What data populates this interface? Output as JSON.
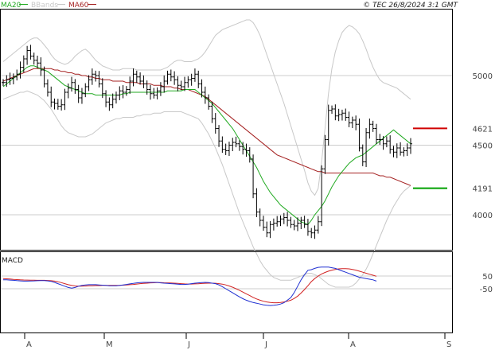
{
  "legend": [
    {
      "label": "MA20",
      "color": "#22aa22"
    },
    {
      "label": "BBands",
      "color": "#c8c8c8"
    },
    {
      "label": "MA60",
      "color": "#a52222"
    }
  ],
  "copyright": "© TEC 26/8/2024 3:1 GMT",
  "macd_title": "MACD",
  "colors": {
    "price": "#000000",
    "ma20": "#22aa22",
    "ma60": "#a52222",
    "bbands": "#c8c8c8",
    "macd": "#1f2fd1",
    "signal": "#d12222",
    "target_high": "#d00000",
    "target_low": "#00a000",
    "grid": "#cccccc",
    "frame": "#000000"
  },
  "chart_data": {
    "type": "ohlc",
    "price_axis": {
      "ticks": [
        4000,
        4500,
        5000
      ],
      "tick_labels": [
        "4000",
        "4500",
        "5000"
      ]
    },
    "macd_axis": {
      "ticks": [
        50,
        -50
      ],
      "tick_labels": [
        "50",
        "-50"
      ]
    },
    "x_axis": {
      "month_labels": [
        "A",
        "M",
        "J",
        "J",
        "A",
        "S"
      ]
    },
    "targets": [
      {
        "label": "4621",
        "value": 4621,
        "kind": "high"
      },
      {
        "label": "4191",
        "value": 4191,
        "kind": "low"
      }
    ],
    "close": [
      4950,
      4970,
      4980,
      4990,
      5010,
      5060,
      5120,
      5180,
      5140,
      5110,
      5090,
      5040,
      4940,
      4880,
      4810,
      4800,
      4780,
      4790,
      4880,
      4910,
      4950,
      4900,
      4840,
      4870,
      4920,
      4970,
      5010,
      5000,
      4940,
      4870,
      4810,
      4790,
      4830,
      4860,
      4890,
      4880,
      4900,
      4960,
      5010,
      4990,
      4960,
      4940,
      4900,
      4870,
      4860,
      4890,
      4920,
      4960,
      5010,
      4990,
      4970,
      4930,
      4920,
      4950,
      4970,
      4980,
      5010,
      4940,
      4880,
      4840,
      4780,
      4690,
      4620,
      4530,
      4470,
      4460,
      4500,
      4520,
      4510,
      4490,
      4470,
      4460,
      4400,
      4150,
      4020,
      3960,
      3910,
      3870,
      3930,
      3940,
      3950,
      3970,
      3980,
      3960,
      3930,
      3920,
      3940,
      3960,
      3930,
      3880,
      3870,
      3890,
      3950,
      4330,
      4540,
      4750,
      4760,
      4710,
      4720,
      4730,
      4700,
      4660,
      4680,
      4650,
      4480,
      4380,
      4590,
      4650,
      4620,
      4540,
      4540,
      4510,
      4530,
      4470,
      4450,
      4480,
      4450,
      4460,
      4480,
      4510
    ],
    "ma20": [
      4920,
      4940,
      4960,
      4980,
      5000,
      5020,
      5040,
      5060,
      5070,
      5070,
      5060,
      5050,
      5040,
      5030,
      5010,
      4990,
      4970,
      4950,
      4930,
      4920,
      4910,
      4900,
      4890,
      4880,
      4870,
      4870,
      4870,
      4860,
      4860,
      4860,
      4860,
      4860,
      4860,
      4860,
      4860,
      4870,
      4870,
      4880,
      4880,
      4880,
      4880,
      4880,
      4880,
      4880,
      4880,
      4880,
      4880,
      4880,
      4890,
      4890,
      4890,
      4890,
      4890,
      4900,
      4900,
      4900,
      4900,
      4880,
      4860,
      4840,
      4820,
      4800,
      4770,
      4740,
      4710,
      4680,
      4650,
      4620,
      4580,
      4540,
      4500,
      4460,
      4420,
      4380,
      4340,
      4290,
      4240,
      4200,
      4160,
      4130,
      4100,
      4070,
      4050,
      4030,
      4010,
      3990,
      3970,
      3950,
      3940,
      3930,
      3960,
      4000,
      4030,
      4060,
      4100,
      4150,
      4200,
      4240,
      4280,
      4310,
      4340,
      4370,
      4390,
      4410,
      4420,
      4430,
      4450,
      4470,
      4490,
      4510,
      4530,
      4550,
      4570,
      4590,
      4610,
      4590,
      4570,
      4550,
      4530,
      4510
    ],
    "ma60": [
      4960,
      4970,
      4980,
      4990,
      5000,
      5010,
      5020,
      5030,
      5040,
      5050,
      5050,
      5050,
      5050,
      5050,
      5050,
      5040,
      5040,
      5030,
      5030,
      5020,
      5020,
      5010,
      5010,
      5000,
      5000,
      4990,
      4990,
      4980,
      4980,
      4970,
      4970,
      4970,
      4960,
      4960,
      4960,
      4960,
      4950,
      4950,
      4950,
      4950,
      4940,
      4940,
      4940,
      4940,
      4930,
      4930,
      4930,
      4920,
      4920,
      4920,
      4910,
      4910,
      4900,
      4900,
      4900,
      4890,
      4880,
      4870,
      4860,
      4850,
      4830,
      4810,
      4790,
      4770,
      4750,
      4730,
      4710,
      4690,
      4670,
      4650,
      4630,
      4610,
      4590,
      4570,
      4550,
      4530,
      4510,
      4490,
      4470,
      4450,
      4430,
      4420,
      4410,
      4400,
      4390,
      4380,
      4370,
      4360,
      4350,
      4340,
      4330,
      4320,
      4310,
      4310,
      4300,
      4300,
      4300,
      4300,
      4300,
      4300,
      4300,
      4300,
      4300,
      4300,
      4300,
      4300,
      4300,
      4300,
      4300,
      4290,
      4280,
      4280,
      4270,
      4270,
      4260,
      4250,
      4240,
      4230,
      4220,
      4210
    ],
    "bb_upper": [
      5100,
      5120,
      5140,
      5160,
      5180,
      5200,
      5220,
      5240,
      5260,
      5270,
      5270,
      5250,
      5220,
      5190,
      5150,
      5120,
      5100,
      5090,
      5080,
      5090,
      5110,
      5140,
      5160,
      5180,
      5190,
      5170,
      5140,
      5110,
      5090,
      5070,
      5060,
      5050,
      5040,
      5040,
      5040,
      5050,
      5050,
      5050,
      5050,
      5040,
      5040,
      5040,
      5040,
      5040,
      5040,
      5040,
      5040,
      5050,
      5060,
      5080,
      5100,
      5110,
      5110,
      5100,
      5100,
      5100,
      5110,
      5120,
      5140,
      5170,
      5210,
      5250,
      5290,
      5310,
      5330,
      5340,
      5350,
      5360,
      5370,
      5380,
      5390,
      5400,
      5400,
      5380,
      5340,
      5290,
      5220,
      5150,
      5080,
      5010,
      4940,
      4870,
      4800,
      4720,
      4640,
      4560,
      4480,
      4400,
      4320,
      4230,
      4170,
      4140,
      4190,
      4380,
      4620,
      4870,
      5050,
      5170,
      5250,
      5310,
      5340,
      5360,
      5350,
      5330,
      5300,
      5250,
      5190,
      5120,
      5060,
      5010,
      4970,
      4950,
      4940,
      4930,
      4920,
      4910,
      4890,
      4870,
      4850,
      4830
    ],
    "bb_lower": [
      4830,
      4840,
      4850,
      4860,
      4870,
      4880,
      4880,
      4890,
      4880,
      4870,
      4860,
      4840,
      4820,
      4790,
      4760,
      4720,
      4680,
      4640,
      4610,
      4590,
      4580,
      4570,
      4560,
      4560,
      4560,
      4570,
      4580,
      4600,
      4620,
      4640,
      4660,
      4670,
      4680,
      4690,
      4690,
      4700,
      4700,
      4700,
      4700,
      4710,
      4710,
      4720,
      4720,
      4720,
      4730,
      4730,
      4730,
      4740,
      4740,
      4740,
      4740,
      4740,
      4740,
      4730,
      4720,
      4710,
      4700,
      4690,
      4660,
      4620,
      4580,
      4530,
      4480,
      4420,
      4360,
      4290,
      4220,
      4150,
      4080,
      4010,
      3950,
      3890,
      3830,
      3770,
      3720,
      3670,
      3630,
      3600,
      3570,
      3550,
      3540,
      3530,
      3530,
      3530,
      3530,
      3540,
      3550,
      3560,
      3570,
      3580,
      3580,
      3570,
      3560,
      3540,
      3520,
      3500,
      3490,
      3480,
      3480,
      3480,
      3480,
      3480,
      3490,
      3510,
      3540,
      3570,
      3610,
      3660,
      3720,
      3780,
      3840,
      3900,
      3960,
      4010,
      4060,
      4100,
      4140,
      4170,
      4190,
      4210
    ],
    "macd": [
      20,
      20,
      18,
      16,
      14,
      12,
      10,
      10,
      11,
      12,
      13,
      14,
      14,
      12,
      8,
      0,
      -10,
      -20,
      -30,
      -40,
      -45,
      -40,
      -30,
      -24,
      -20,
      -18,
      -18,
      -18,
      -20,
      -22,
      -24,
      -26,
      -26,
      -26,
      -24,
      -20,
      -16,
      -12,
      -8,
      -4,
      -2,
      0,
      0,
      0,
      0,
      0,
      -4,
      -6,
      -8,
      -10,
      -12,
      -14,
      -16,
      -16,
      -14,
      -10,
      -6,
      -4,
      -2,
      0,
      -2,
      -6,
      -10,
      -20,
      -34,
      -50,
      -66,
      -82,
      -98,
      -114,
      -128,
      -140,
      -150,
      -158,
      -164,
      -170,
      -176,
      -180,
      -182,
      -180,
      -176,
      -170,
      -160,
      -140,
      -120,
      -80,
      -30,
      20,
      60,
      95,
      100,
      110,
      118,
      120,
      120,
      120,
      115,
      110,
      100,
      90,
      80,
      70,
      60,
      50,
      40,
      35,
      30,
      25,
      20,
      10
    ],
    "signal": [
      30,
      28,
      26,
      24,
      22,
      20,
      19,
      18,
      17,
      17,
      16,
      16,
      16,
      15,
      13,
      10,
      5,
      -2,
      -10,
      -18,
      -24,
      -28,
      -30,
      -30,
      -29,
      -27,
      -26,
      -25,
      -25,
      -24,
      -24,
      -24,
      -24,
      -24,
      -23,
      -22,
      -20,
      -18,
      -16,
      -13,
      -10,
      -8,
      -6,
      -4,
      -3,
      -2,
      -2,
      -3,
      -4,
      -5,
      -6,
      -8,
      -10,
      -12,
      -13,
      -13,
      -12,
      -11,
      -9,
      -7,
      -6,
      -6,
      -7,
      -10,
      -14,
      -20,
      -28,
      -38,
      -50,
      -62,
      -76,
      -90,
      -104,
      -118,
      -130,
      -140,
      -148,
      -154,
      -158,
      -160,
      -160,
      -158,
      -154,
      -148,
      -140,
      -126,
      -108,
      -84,
      -56,
      -26,
      6,
      30,
      50,
      66,
      78,
      88,
      96,
      102,
      106,
      108,
      108,
      106,
      102,
      96,
      88,
      80,
      72,
      64,
      56,
      48
    ]
  }
}
